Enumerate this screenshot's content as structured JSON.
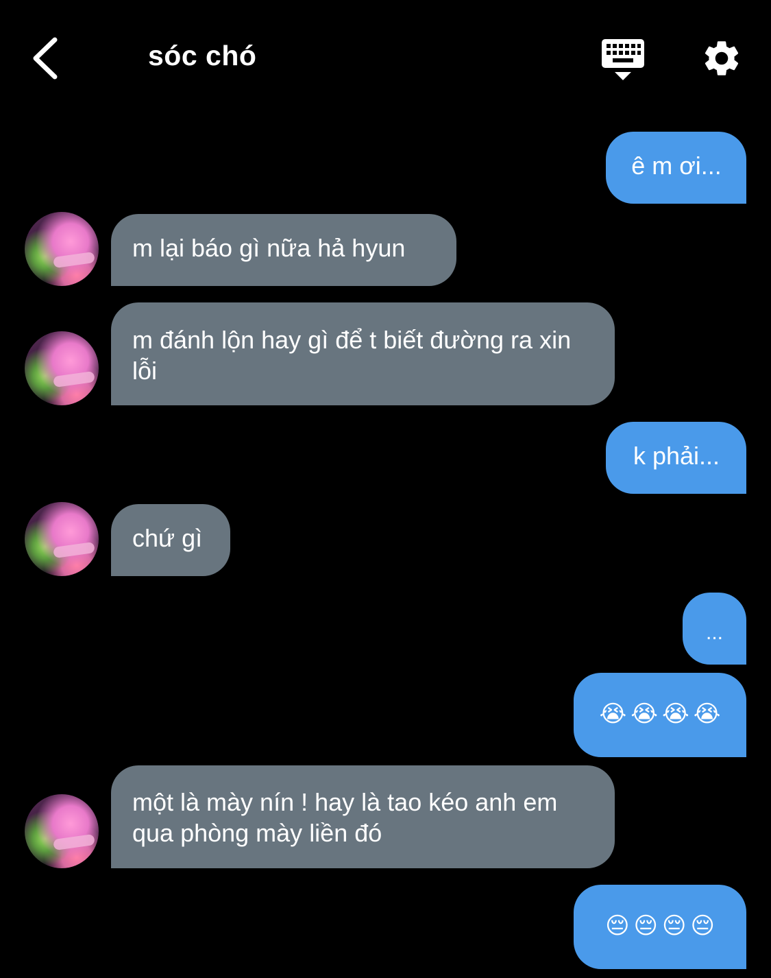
{
  "header": {
    "title": "sóc chó",
    "back_icon": "chevron-left-icon",
    "keyboard_icon": "keyboard-hide-icon",
    "settings_icon": "gear-icon"
  },
  "colors": {
    "background": "#000000",
    "incoming_bubble": "#68757f",
    "outgoing_bubble": "#4a9aea",
    "text": "#ffffff"
  },
  "messages": [
    {
      "from": "me",
      "text": "ê m ơi..."
    },
    {
      "from": "them",
      "text": "m lại báo gì nữa hả hyun"
    },
    {
      "from": "them",
      "text": "m đánh lộn hay gì để t biết đường ra xin lỗi"
    },
    {
      "from": "me",
      "text": "k phải..."
    },
    {
      "from": "them",
      "text": "chứ gì"
    },
    {
      "from": "me",
      "text": "..."
    },
    {
      "from": "me",
      "text": "😭😭😭😭"
    },
    {
      "from": "them",
      "text": "một là mày nín ! hay là tao kéo anh em qua phòng mày liền đó"
    },
    {
      "from": "me",
      "text": "😔😔😔😔"
    }
  ]
}
